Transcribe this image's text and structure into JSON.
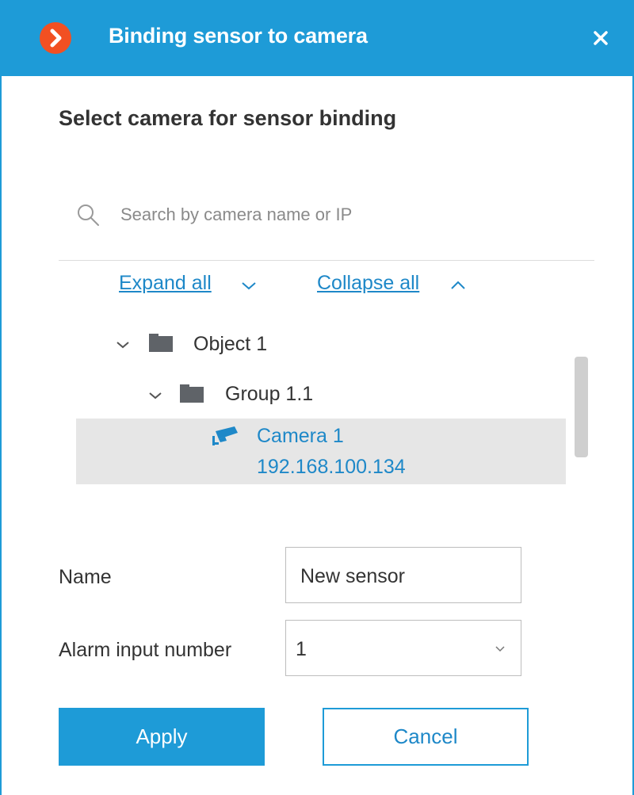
{
  "window": {
    "title": "Binding sensor to camera",
    "logo_icon": "app-logo-chevron",
    "close_icon": "close-icon",
    "accent_color": "#1e9bd7"
  },
  "heading": "Select camera for sensor binding",
  "search": {
    "placeholder": "Search by camera name or IP",
    "value": ""
  },
  "tree_controls": {
    "expand_label": "Expand all",
    "collapse_label": "Collapse all"
  },
  "tree": {
    "object": {
      "label": "Object 1",
      "expanded": true
    },
    "group": {
      "label": "Group 1.1",
      "expanded": true
    },
    "camera": {
      "name": "Camera 1",
      "ip": "192.168.100.134",
      "selected": true
    }
  },
  "form": {
    "name_label": "Name",
    "name_value": "New sensor",
    "alarm_label": "Alarm input number",
    "alarm_value": "1"
  },
  "buttons": {
    "apply": "Apply",
    "cancel": "Cancel"
  }
}
